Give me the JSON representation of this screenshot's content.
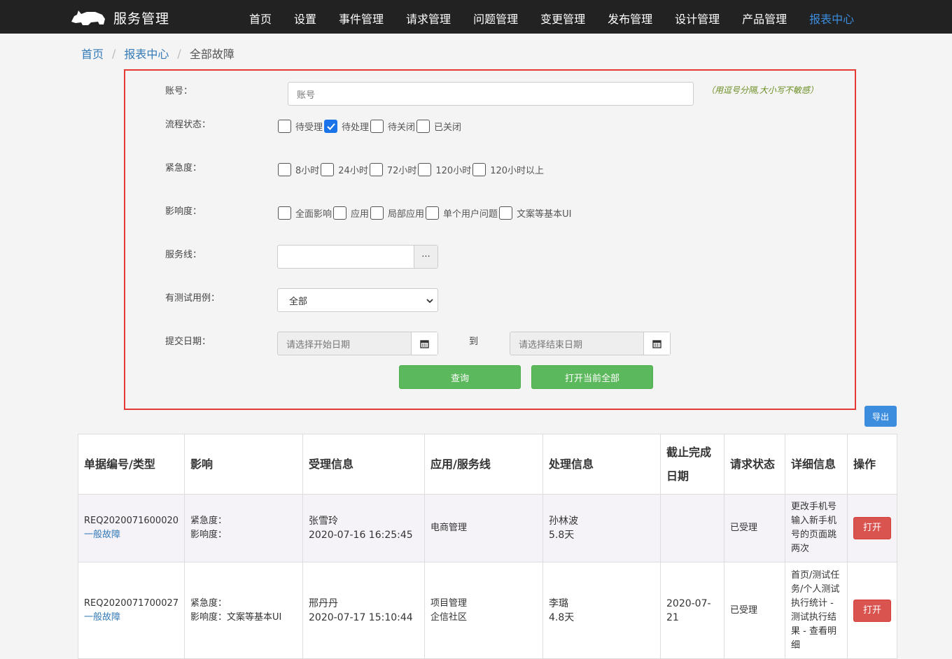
{
  "brand": {
    "title": "服务管理"
  },
  "nav": {
    "items": [
      {
        "label": "首页"
      },
      {
        "label": "设置"
      },
      {
        "label": "事件管理"
      },
      {
        "label": "请求管理"
      },
      {
        "label": "问题管理"
      },
      {
        "label": "变更管理"
      },
      {
        "label": "发布管理"
      },
      {
        "label": "设计管理"
      },
      {
        "label": "产品管理"
      },
      {
        "label": "报表中心",
        "active": true
      }
    ]
  },
  "breadcrumb": {
    "home": "首页",
    "section": "报表中心",
    "current": "全部故障",
    "separator": "/"
  },
  "filter": {
    "account": {
      "label": "账号：",
      "placeholder": "账号",
      "hint": "（用逗号分隔,大小写不敏感）"
    },
    "status": {
      "label": "流程状态：",
      "options": [
        {
          "label": "待受理",
          "checked": false
        },
        {
          "label": "待处理",
          "checked": true
        },
        {
          "label": "待关闭",
          "checked": false
        },
        {
          "label": "已关闭",
          "checked": false
        }
      ]
    },
    "urgency": {
      "label": "紧急度：",
      "options": [
        {
          "label": "8小时",
          "checked": false
        },
        {
          "label": "24小时",
          "checked": false
        },
        {
          "label": "72小时",
          "checked": false
        },
        {
          "label": "120小时",
          "checked": false
        },
        {
          "label": "120小时以上",
          "checked": false
        }
      ]
    },
    "impact": {
      "label": "影响度：",
      "options": [
        {
          "label": "全面影响",
          "checked": false
        },
        {
          "label": "应用",
          "checked": false
        },
        {
          "label": "局部应用",
          "checked": false
        },
        {
          "label": "单个用户问题",
          "checked": false
        },
        {
          "label": "文案等基本UI",
          "checked": false
        }
      ]
    },
    "service_line": {
      "label": "服务线：",
      "value": "",
      "addon": "···"
    },
    "test_case": {
      "label": "有测试用例：",
      "selected": "全部"
    },
    "date": {
      "label": "提交日期：",
      "start_placeholder": "请选择开始日期",
      "to": "到",
      "end_placeholder": "请选择结束日期"
    },
    "buttons": {
      "query": "查询",
      "open_all": "打开当前全部"
    }
  },
  "export_label": "导出",
  "table": {
    "headers": {
      "id_type": "单据编号/类型",
      "impact": "影响",
      "accept": "受理信息",
      "app": "应用/服务线",
      "handle": "处理信息",
      "deadline": "截止完成日期",
      "status": "请求状态",
      "detail": "详细信息",
      "action": "操作"
    },
    "rows": [
      {
        "id": "REQ2020071600020",
        "type": "一般故障",
        "urgency": "紧急度：",
        "impact": "影响度：",
        "acceptor": "张雪玲",
        "accept_time": "2020-07-16 16:25:45",
        "app": "电商管理",
        "service_line": "",
        "handler": "孙林波",
        "duration": "5.8天",
        "deadline": "",
        "status": "已受理",
        "detail": "更改手机号输入新手机号的页面跳两次",
        "action": "打开"
      },
      {
        "id": "REQ2020071700027",
        "type": "一般故障",
        "urgency": "紧急度：",
        "impact": "影响度：文案等基本UI",
        "acceptor": "邢丹丹",
        "accept_time": "2020-07-17 15:10:44",
        "app": "项目管理",
        "service_line": "企信社区",
        "handler": "李璐",
        "duration": "4.8天",
        "deadline": "2020-07-21",
        "status": "已受理",
        "detail": "首页/测试任务/个人测试执行统计 - 测试执行结果 - 查看明细",
        "action": "打开"
      }
    ]
  },
  "icons": {
    "logo": "rhino-icon",
    "calendar": "calendar-icon",
    "check": "check-icon",
    "select": "chevron-down-icon"
  }
}
